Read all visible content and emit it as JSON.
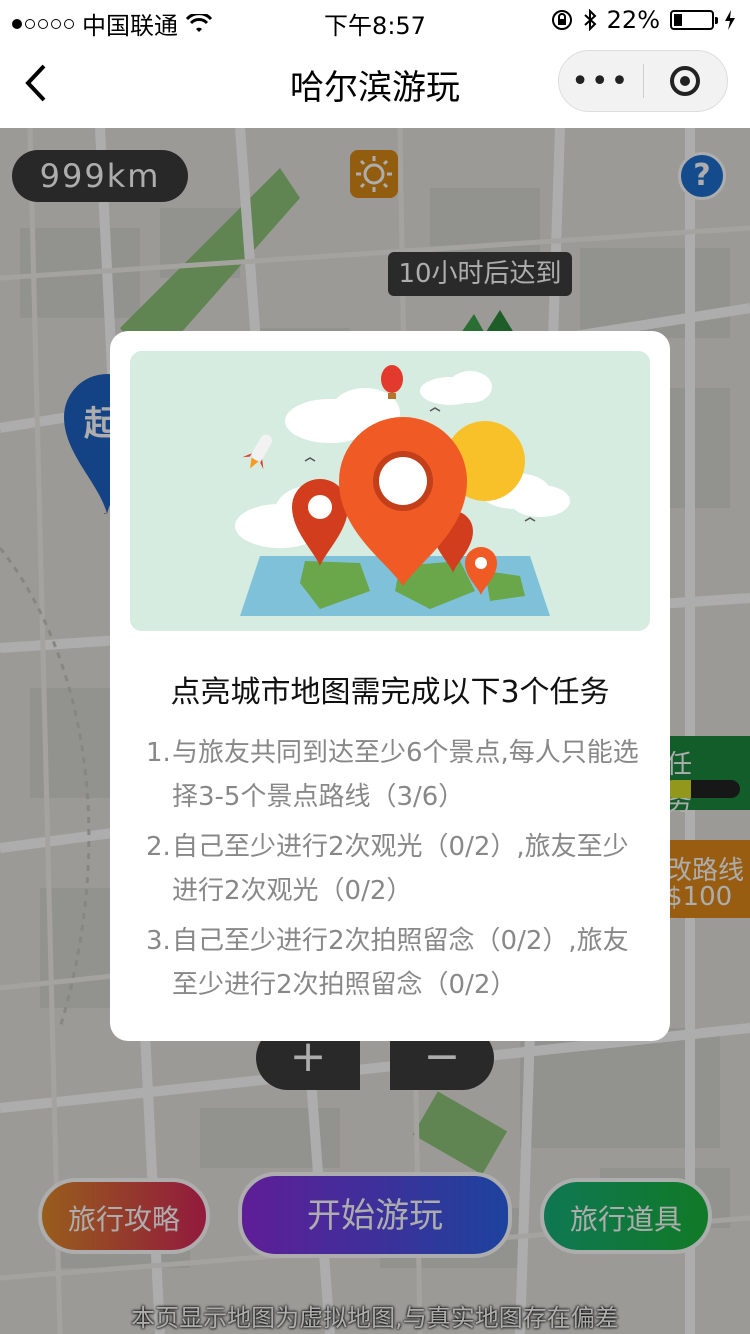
{
  "status_bar": {
    "carrier": "中国联通",
    "time": "下午8:57",
    "battery": "22%",
    "battery_level": 0.22
  },
  "nav": {
    "title": "哈尔滨游玩",
    "more_label": "•••"
  },
  "map": {
    "distance": "999km",
    "weather_icon": "sun-icon",
    "help_label": "?",
    "arrive_tip": "10小时后达到",
    "start_marker": "起",
    "task_tab": {
      "label": "任 务",
      "progress": 0.35
    },
    "route_tab": {
      "line1": "改路线",
      "line2": "$100"
    },
    "zoom_in": "+",
    "zoom_out": "−",
    "buttons": {
      "guide": "旅行攻略",
      "start": "开始游玩",
      "tools": "旅行道具"
    },
    "disclaimer": "本页显示地图为虚拟地图,与真实地图存在偏差"
  },
  "modal": {
    "heading": "点亮城市地图需完成以下3个任务",
    "tasks": [
      {
        "num": "1.",
        "text": "与旅友共同到达至少6个景点,每人只能选择3-5个景点路线（3/6）"
      },
      {
        "num": "2.",
        "text": "自己至少进行2次观光（0/2）,旅友至少进行2次观光（0/2）"
      },
      {
        "num": "3.",
        "text": "自己至少进行2次拍照留念（0/2）,旅友至少进行2次拍照留念（0/2）"
      }
    ]
  },
  "colors": {
    "pin_orange": "#f05a24",
    "task_green": "#1b8a3e",
    "route_orange": "#e08a18"
  }
}
